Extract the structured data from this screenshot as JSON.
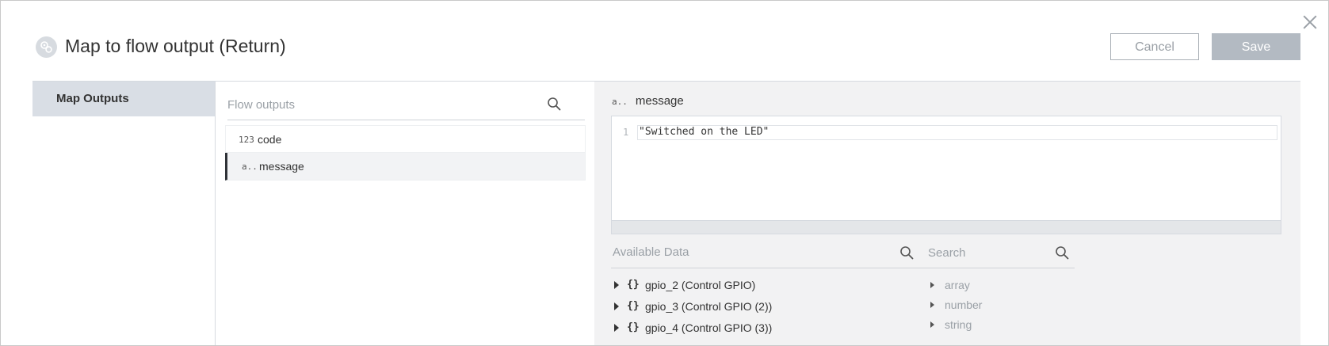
{
  "dialog": {
    "title": "Map to flow output (Return)",
    "cancel_label": "Cancel",
    "save_label": "Save",
    "colors": {
      "save_bg": "#b3bac2",
      "active_marker": "#2f3237",
      "sidebar_active": "#d9dee5"
    }
  },
  "sidebar": {
    "items": [
      {
        "label": "Map Outputs",
        "active": true
      }
    ]
  },
  "flow_outputs": {
    "search_placeholder": "Flow outputs",
    "items": [
      {
        "type_tag": "123",
        "label": "code",
        "active": false
      },
      {
        "type_tag": "a..",
        "label": "message",
        "active": true
      }
    ]
  },
  "mapping": {
    "field_type_tag": "a..",
    "field_name": "message",
    "editor": {
      "line_number": "1",
      "code": "\"Switched on the LED\""
    },
    "available_data": {
      "label": "Available Data",
      "items": [
        {
          "label": "gpio_2 (Control GPIO)"
        },
        {
          "label": "gpio_3 (Control GPIO (2))"
        },
        {
          "label": "gpio_4 (Control GPIO (3))"
        }
      ]
    },
    "functions": {
      "search_placeholder": "Search",
      "items": [
        {
          "label": "array"
        },
        {
          "label": "number"
        },
        {
          "label": "string"
        }
      ]
    }
  }
}
